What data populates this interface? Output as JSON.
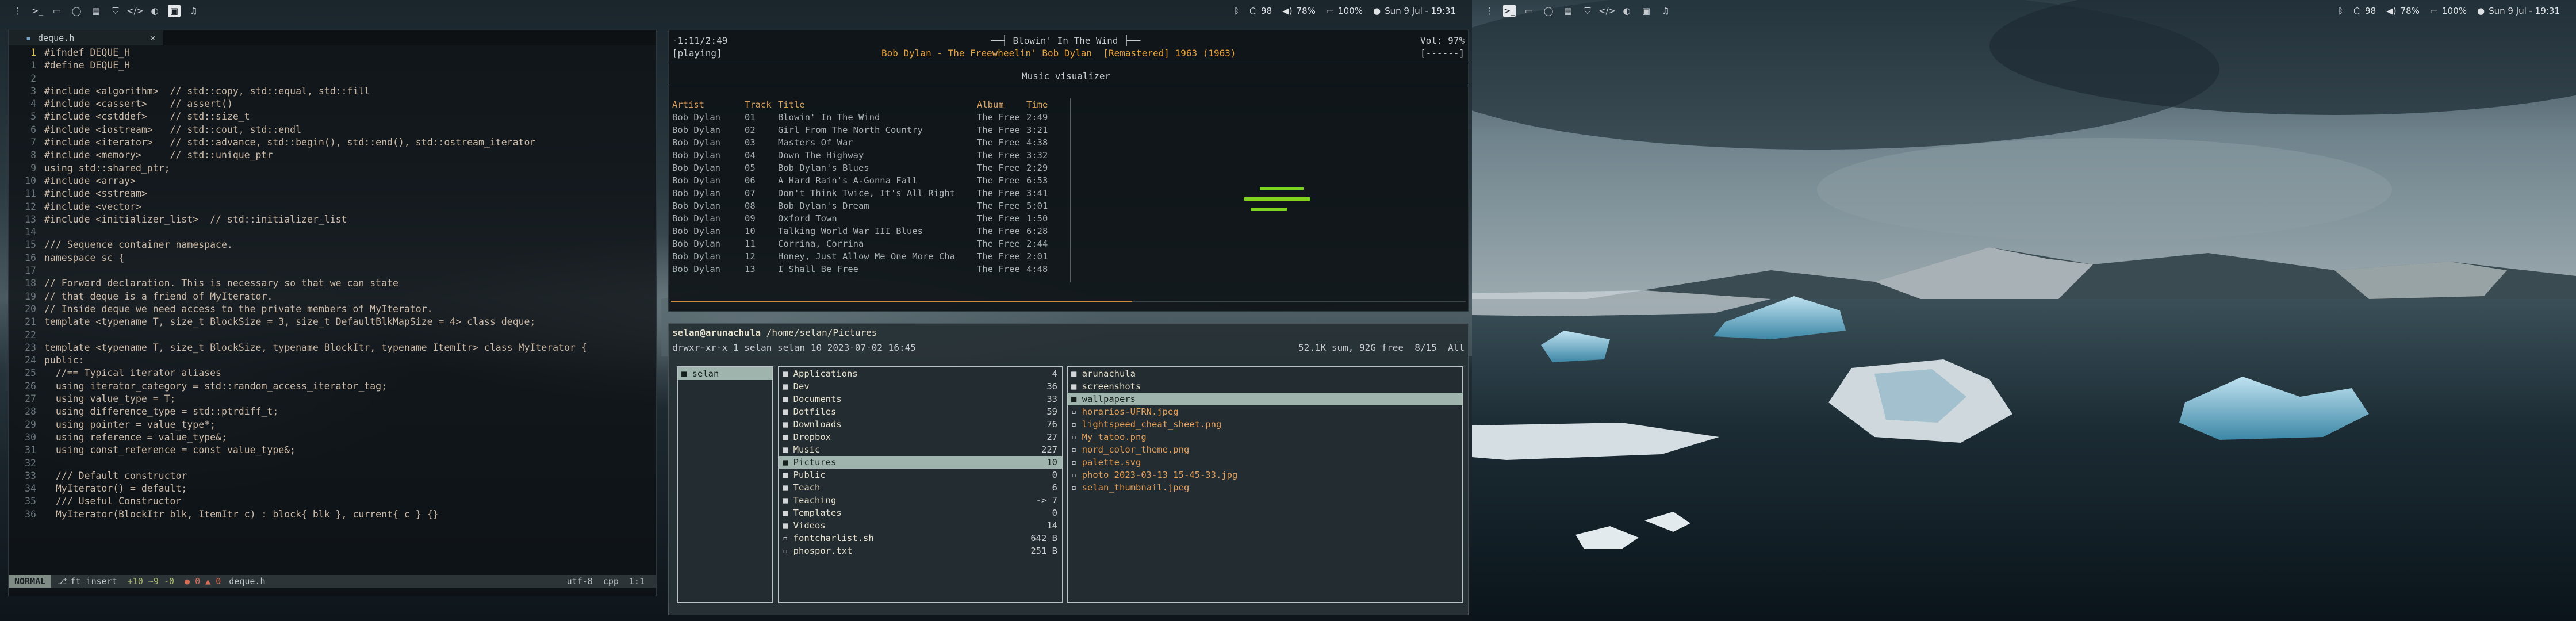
{
  "left_bar": {
    "stats": [
      {
        "icon": "bluetooth-icon",
        "label": ""
      },
      {
        "icon": "package-icon",
        "label": "98"
      },
      {
        "icon": "volume-icon",
        "label": "78%"
      },
      {
        "icon": "battery-icon",
        "label": "100%"
      },
      {
        "icon": "dot-icon",
        "label": "Sun 9 Jul - 19:31"
      }
    ]
  },
  "right_bar": {
    "stats": [
      {
        "icon": "bluetooth-icon",
        "label": ""
      },
      {
        "icon": "package-icon",
        "label": "98"
      },
      {
        "icon": "volume-icon",
        "label": "78%"
      },
      {
        "icon": "battery-icon",
        "label": "100%"
      },
      {
        "icon": "dot-icon",
        "label": "Sun 9 Jul - 19:31"
      }
    ]
  },
  "editor": {
    "tab_name": "deque.h",
    "tab_close": "✕",
    "lines": [
      {
        "n": "1",
        "t": "#ifndef DEQUE_H",
        "c": "pp"
      },
      {
        "n": "1",
        "t": "#define DEQUE_H",
        "c": "pp"
      },
      {
        "n": "2",
        "t": "",
        "c": ""
      },
      {
        "n": "3",
        "t": "#include <algorithm>  // std::copy, std::equal, std::fill",
        "c": "pp"
      },
      {
        "n": "4",
        "t": "#include <cassert>    // assert()",
        "c": "pp"
      },
      {
        "n": "5",
        "t": "#include <cstddef>    // std::size_t",
        "c": "pp"
      },
      {
        "n": "6",
        "t": "#include <iostream>   // std::cout, std::endl",
        "c": "pp"
      },
      {
        "n": "7",
        "t": "#include <iterator>   // std::advance, std::begin(), std::end(), std::ostream_iterator",
        "c": "pp"
      },
      {
        "n": "8",
        "t": "#include <memory>     // std::unique_ptr",
        "c": "pp"
      },
      {
        "n": "9",
        "t": "using std::shared_ptr;",
        "c": "kw"
      },
      {
        "n": "10",
        "t": "#include <array>",
        "c": "pp"
      },
      {
        "n": "11",
        "t": "#include <sstream>",
        "c": "pp"
      },
      {
        "n": "12",
        "t": "#include <vector>",
        "c": "pp"
      },
      {
        "n": "13",
        "t": "#include <initializer_list>  // std::initializer_list",
        "c": "pp"
      },
      {
        "n": "14",
        "t": "",
        "c": ""
      },
      {
        "n": "15",
        "t": "/// Sequence container namespace.",
        "c": "cmt"
      },
      {
        "n": "16",
        "t": "namespace sc {",
        "c": "kw"
      },
      {
        "n": "17",
        "t": "",
        "c": ""
      },
      {
        "n": "18",
        "t": "// Forward declaration. This is necessary so that we can state",
        "c": "cmt"
      },
      {
        "n": "19",
        "t": "// that deque is a friend of MyIterator.",
        "c": "cmt"
      },
      {
        "n": "20",
        "t": "// Inside deque we need access to the private members of MyIterator.",
        "c": "cmt"
      },
      {
        "n": "21",
        "t": "template <typename T, size_t BlockSize = 3, size_t DefaultBlkMapSize = 4> class deque;",
        "c": "kw"
      },
      {
        "n": "22",
        "t": "",
        "c": ""
      },
      {
        "n": "23",
        "t": "template <typename T, size_t BlockSize, typename BlockItr, typename ItemItr> class MyIterator {",
        "c": "kw"
      },
      {
        "n": "24",
        "t": "public:",
        "c": "ty"
      },
      {
        "n": "25",
        "t": "  //== Typical iterator aliases",
        "c": "cmt"
      },
      {
        "n": "26",
        "t": "  using iterator_category = std::random_access_iterator_tag;",
        "c": "kw"
      },
      {
        "n": "27",
        "t": "  using value_type = T;",
        "c": "kw"
      },
      {
        "n": "28",
        "t": "  using difference_type = std::ptrdiff_t;",
        "c": "kw"
      },
      {
        "n": "29",
        "t": "  using pointer = value_type*;",
        "c": "kw"
      },
      {
        "n": "30",
        "t": "  using reference = value_type&;",
        "c": "kw"
      },
      {
        "n": "31",
        "t": "  using const_reference = const value_type&;",
        "c": "kw"
      },
      {
        "n": "32",
        "t": "",
        "c": ""
      },
      {
        "n": "33",
        "t": "  /// Default constructor",
        "c": "cmt"
      },
      {
        "n": "34",
        "t": "  MyIterator() = default;",
        "c": "ty"
      },
      {
        "n": "35",
        "t": "  /// Useful Constructor",
        "c": "cmt"
      },
      {
        "n": "36",
        "t": "  MyIterator(BlockItr blk, ItemItr c) : block{ blk }, current{ c } {}",
        "c": "ty"
      }
    ],
    "status": {
      "mode": "NORMAL",
      "branch": "ft_insert",
      "diff": "+10 ~9 -0",
      "diag": "● 0  ▲ 0",
      "file": "deque.h",
      "encoding": "utf-8",
      "filetype": "cpp",
      "position": "1:1"
    }
  },
  "music": {
    "time": "-1:11/2:49",
    "title_line": "Blowin' In The Wind",
    "volume": "Vol: 97%",
    "state": "[playing]",
    "now_artist": "Bob Dylan",
    "now_rest": " - The Freewheelin' Bob Dylan  [Remastered] 1963 (1963)",
    "flags": "[------]",
    "visualizer_title": "Music visualizer",
    "headers": {
      "artist": "Artist",
      "track": "Track",
      "title": "Title",
      "album": "Album",
      "time": "Time"
    },
    "tracks": [
      {
        "artist": "Bob Dylan",
        "num": "01",
        "title": "Blowin' In The Wind",
        "album": "The Free",
        "time": "2:49"
      },
      {
        "artist": "Bob Dylan",
        "num": "02",
        "title": "Girl From The North Country",
        "album": "The Free",
        "time": "3:21"
      },
      {
        "artist": "Bob Dylan",
        "num": "03",
        "title": "Masters Of War",
        "album": "The Free",
        "time": "4:38"
      },
      {
        "artist": "Bob Dylan",
        "num": "04",
        "title": "Down The Highway",
        "album": "The Free",
        "time": "3:32"
      },
      {
        "artist": "Bob Dylan",
        "num": "05",
        "title": "Bob Dylan's Blues",
        "album": "The Free",
        "time": "2:29"
      },
      {
        "artist": "Bob Dylan",
        "num": "06",
        "title": "A Hard Rain's A-Gonna Fall",
        "album": "The Free",
        "time": "6:53"
      },
      {
        "artist": "Bob Dylan",
        "num": "07",
        "title": "Don't Think Twice, It's All Right",
        "album": "The Free",
        "time": "3:41"
      },
      {
        "artist": "Bob Dylan",
        "num": "08",
        "title": "Bob Dylan's Dream",
        "album": "The Free",
        "time": "5:01"
      },
      {
        "artist": "Bob Dylan",
        "num": "09",
        "title": "Oxford Town",
        "album": "The Free",
        "time": "1:50"
      },
      {
        "artist": "Bob Dylan",
        "num": "10",
        "title": "Talking World War III Blues",
        "album": "The Free",
        "time": "6:28"
      },
      {
        "artist": "Bob Dylan",
        "num": "11",
        "title": "Corrina, Corrina",
        "album": "The Free",
        "time": "2:44"
      },
      {
        "artist": "Bob Dylan",
        "num": "12",
        "title": "Honey, Just Allow Me One More Cha",
        "album": "The Free",
        "time": "2:01"
      },
      {
        "artist": "Bob Dylan",
        "num": "13",
        "title": "I Shall Be Free",
        "album": "The Free",
        "time": "4:48"
      }
    ],
    "progress_fraction": 0.58
  },
  "fm": {
    "prompt": "selan@arunachula",
    "path": " /home/selan/Pictures",
    "info_left": "drwxr-xr-x 1 selan selan 10 2023-07-02 16:45",
    "info_right": "52.1K sum, 92G free  8/15  All",
    "left_items": [
      {
        "name": "selan",
        "selected": true
      }
    ],
    "mid_items": [
      {
        "name": "Applications",
        "size": "4"
      },
      {
        "name": "Dev",
        "size": "36"
      },
      {
        "name": "Documents",
        "size": "33"
      },
      {
        "name": "Dotfiles",
        "size": "59"
      },
      {
        "name": "Downloads",
        "size": "76"
      },
      {
        "name": "Dropbox",
        "size": "27"
      },
      {
        "name": "Music",
        "size": "227"
      },
      {
        "name": "Pictures",
        "size": "10",
        "selected": true
      },
      {
        "name": "Public",
        "size": "0"
      },
      {
        "name": "Teach",
        "size": "6"
      },
      {
        "name": "Teaching",
        "size": "-> 7"
      },
      {
        "name": "Templates",
        "size": "0"
      },
      {
        "name": "Videos",
        "size": "14"
      },
      {
        "name": "fontcharlist.sh",
        "size": "642 B",
        "file": true
      },
      {
        "name": "phospor.txt",
        "size": "251 B",
        "file": true
      }
    ],
    "right_items": [
      {
        "name": "arunachula",
        "dir": true
      },
      {
        "name": "screenshots",
        "dir": true
      },
      {
        "name": "wallpapers",
        "dir": true,
        "selected": true
      },
      {
        "name": "horarios-UFRN.jpeg"
      },
      {
        "name": "lightspeed_cheat_sheet.png"
      },
      {
        "name": "My_tatoo.png"
      },
      {
        "name": "nord_color_theme.png"
      },
      {
        "name": "palette.svg"
      },
      {
        "name": "photo_2023-03-13_15-45-33.jpg"
      },
      {
        "name": "selan_thumbnail.jpeg"
      }
    ]
  },
  "colors": {
    "accent": "#9fb4ac",
    "music_accent": "#e8a23c",
    "visualizer": "#7ed321"
  }
}
